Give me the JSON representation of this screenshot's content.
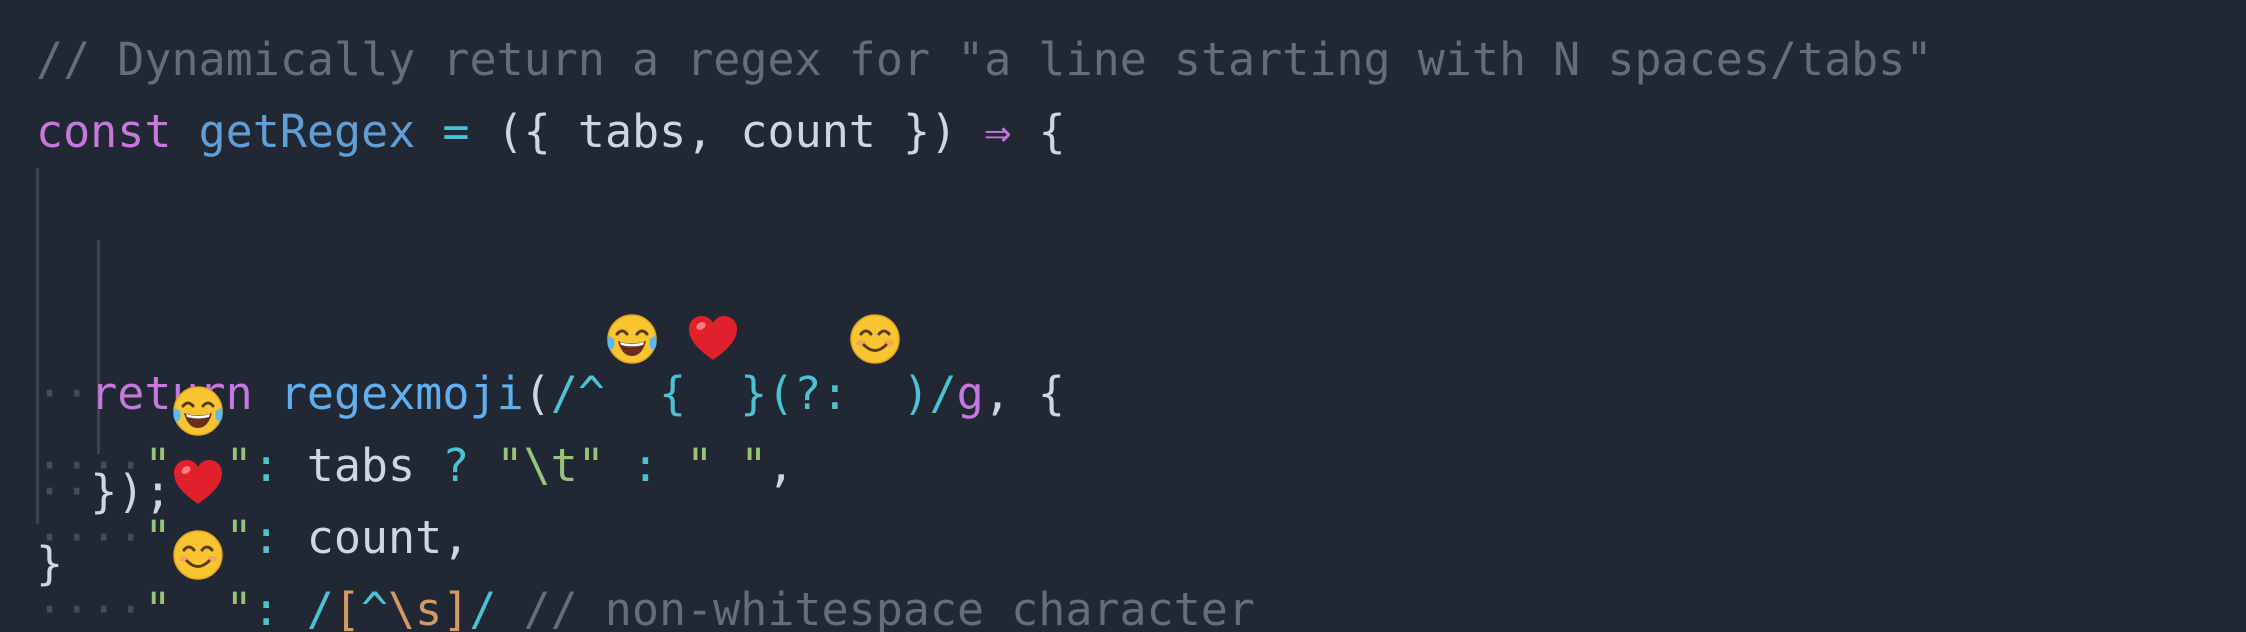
{
  "editor": {
    "lines": [
      {
        "indent": "",
        "tokens": [
          {
            "t": "comment",
            "v": "// Dynamically return a regex for \"a line starting with N spaces/tabs\""
          }
        ]
      },
      {
        "indent": "",
        "tokens": [
          {
            "t": "keyword",
            "v": "const"
          },
          {
            "t": "plain",
            "v": " "
          },
          {
            "t": "def",
            "v": "getRegex"
          },
          {
            "t": "plain",
            "v": " "
          },
          {
            "t": "op",
            "v": "="
          },
          {
            "t": "plain",
            "v": " ({ tabs, count }) "
          },
          {
            "t": "arrow",
            "v": "⇒"
          },
          {
            "t": "plain",
            "v": " {"
          }
        ]
      },
      {
        "indent": "··",
        "tokens": [
          {
            "t": "keyword",
            "v": "return"
          },
          {
            "t": "plain",
            "v": " "
          },
          {
            "t": "fn",
            "v": "regexmoji"
          },
          {
            "t": "plain",
            "v": "("
          },
          {
            "t": "regex",
            "v": "/^"
          },
          {
            "t": "emoji",
            "v": "joy-emoji"
          },
          {
            "t": "regex",
            "v": "{"
          },
          {
            "t": "emoji",
            "v": "heart-emoji"
          },
          {
            "t": "regex",
            "v": "}(?:"
          },
          {
            "t": "emoji",
            "v": "smile-emoji"
          },
          {
            "t": "regex",
            "v": ")/"
          },
          {
            "t": "regex-flag",
            "v": "g"
          },
          {
            "t": "plain",
            "v": ", {"
          }
        ]
      },
      {
        "indent": "····",
        "tokens": [
          {
            "t": "string",
            "v": "\""
          },
          {
            "t": "emoji",
            "v": "joy-emoji"
          },
          {
            "t": "string",
            "v": "\""
          },
          {
            "t": "op",
            "v": ":"
          },
          {
            "t": "plain",
            "v": " tabs "
          },
          {
            "t": "op",
            "v": "?"
          },
          {
            "t": "plain",
            "v": " "
          },
          {
            "t": "string",
            "v": "\"\\t\""
          },
          {
            "t": "plain",
            "v": " "
          },
          {
            "t": "op",
            "v": ":"
          },
          {
            "t": "plain",
            "v": " "
          },
          {
            "t": "string",
            "v": "\" \""
          },
          {
            "t": "plain",
            "v": ","
          }
        ]
      },
      {
        "indent": "····",
        "tokens": [
          {
            "t": "string",
            "v": "\""
          },
          {
            "t": "emoji",
            "v": "heart-emoji"
          },
          {
            "t": "string",
            "v": "\""
          },
          {
            "t": "op",
            "v": ":"
          },
          {
            "t": "plain",
            "v": " count,"
          }
        ]
      },
      {
        "indent": "····",
        "tokens": [
          {
            "t": "string",
            "v": "\""
          },
          {
            "t": "emoji",
            "v": "smile-emoji"
          },
          {
            "t": "string",
            "v": "\""
          },
          {
            "t": "op",
            "v": ":"
          },
          {
            "t": "plain",
            "v": " "
          },
          {
            "t": "regex",
            "v": "/"
          },
          {
            "t": "class",
            "v": "["
          },
          {
            "t": "regex",
            "v": "^"
          },
          {
            "t": "class",
            "v": "\\s]"
          },
          {
            "t": "regex",
            "v": "/"
          },
          {
            "t": "plain",
            "v": " "
          },
          {
            "t": "comment",
            "v": "// non-whitespace character"
          }
        ]
      },
      {
        "indent": "··",
        "tokens": [
          {
            "t": "plain",
            "v": "});"
          }
        ]
      },
      {
        "indent": "",
        "tokens": [
          {
            "t": "plain",
            "v": "}"
          }
        ]
      }
    ]
  },
  "colors": {
    "background": "#212733",
    "comment": "#656d7c",
    "keyword": "#c678dd",
    "function": "#61afef",
    "regex": "#4cc1d3",
    "string": "#98c379",
    "text": "#d0d6e0"
  }
}
